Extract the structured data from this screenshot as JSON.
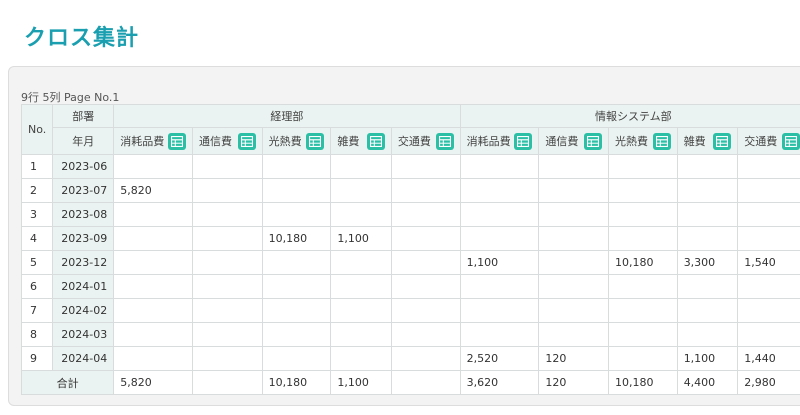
{
  "title": "クロス集計",
  "page_info": "9行 5列 Page No.1",
  "header": {
    "no": "No.",
    "dept": "部署",
    "ym": "年月",
    "groups": [
      "経理部",
      "情報システム部"
    ],
    "columns": [
      "消耗品費",
      "通信費",
      "光熱費",
      "雑費",
      "交通費",
      "消耗品費",
      "通信費",
      "光熱費",
      "雑費",
      "交通費"
    ]
  },
  "rows": [
    {
      "no": "1",
      "ym": "2023-06",
      "values": [
        "",
        "",
        "",
        "",
        "",
        "",
        "",
        "",
        "",
        ""
      ]
    },
    {
      "no": "2",
      "ym": "2023-07",
      "values": [
        "5,820",
        "",
        "",
        "",
        "",
        "",
        "",
        "",
        "",
        ""
      ]
    },
    {
      "no": "3",
      "ym": "2023-08",
      "values": [
        "",
        "",
        "",
        "",
        "",
        "",
        "",
        "",
        "",
        ""
      ]
    },
    {
      "no": "4",
      "ym": "2023-09",
      "values": [
        "",
        "",
        "10,180",
        "1,100",
        "",
        "",
        "",
        "",
        "",
        ""
      ]
    },
    {
      "no": "5",
      "ym": "2023-12",
      "values": [
        "",
        "",
        "",
        "",
        "",
        "1,100",
        "",
        "10,180",
        "3,300",
        "1,540"
      ]
    },
    {
      "no": "6",
      "ym": "2024-01",
      "values": [
        "",
        "",
        "",
        "",
        "",
        "",
        "",
        "",
        "",
        ""
      ]
    },
    {
      "no": "7",
      "ym": "2024-02",
      "values": [
        "",
        "",
        "",
        "",
        "",
        "",
        "",
        "",
        "",
        ""
      ]
    },
    {
      "no": "8",
      "ym": "2024-03",
      "values": [
        "",
        "",
        "",
        "",
        "",
        "",
        "",
        "",
        "",
        ""
      ]
    },
    {
      "no": "9",
      "ym": "2024-04",
      "values": [
        "",
        "",
        "",
        "",
        "",
        "2,520",
        "120",
        "",
        "1,100",
        "1,440"
      ]
    }
  ],
  "total": {
    "label": "合計",
    "values": [
      "5,820",
      "",
      "10,180",
      "1,100",
      "",
      "3,620",
      "120",
      "10,180",
      "4,400",
      "2,980"
    ]
  },
  "colors": {
    "title": "#1a9fb0",
    "header_bg": "#eaf3f1",
    "icon_bg": "#2bbfa6"
  },
  "icons": {
    "column_menu": "table-icon"
  }
}
